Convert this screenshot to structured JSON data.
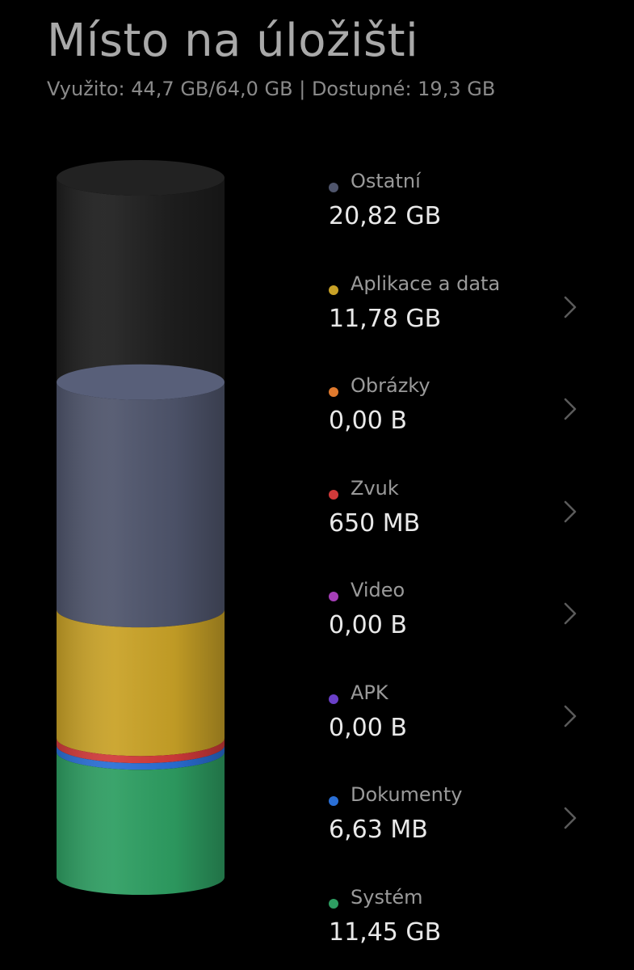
{
  "header": {
    "title": "Místo na úložišti",
    "summary": "Využito: 44,7 GB/64,0 GB | Dostupné: 19,3 GB"
  },
  "categories": [
    {
      "name": "Ostatní",
      "size": "20,82 GB",
      "color": "#4f556c",
      "has_chevron": false
    },
    {
      "name": "Aplikace a data",
      "size": "11,78 GB",
      "color": "#c9a227",
      "has_chevron": true
    },
    {
      "name": "Obrázky",
      "size": "0,00 B",
      "color": "#e07a2e",
      "has_chevron": true
    },
    {
      "name": "Zvuk",
      "size": "650 MB",
      "color": "#d23a3a",
      "has_chevron": true
    },
    {
      "name": "Video",
      "size": "0,00 B",
      "color": "#a63fb8",
      "has_chevron": true
    },
    {
      "name": "APK",
      "size": "0,00 B",
      "color": "#6a3fc8",
      "has_chevron": true
    },
    {
      "name": "Dokumenty",
      "size": "6,63 MB",
      "color": "#2a6fd6",
      "has_chevron": true
    },
    {
      "name": "Systém",
      "size": "11,45 GB",
      "color": "#2e9e62",
      "has_chevron": false
    }
  ],
  "storage_bar": {
    "total_gb": 64.0,
    "segments_bottom_to_top": [
      {
        "name": "Systém",
        "gb": 11.45,
        "color": "#2e9e62"
      },
      {
        "name": "Dokumenty",
        "gb": 0.6,
        "color": "#2a6fd6"
      },
      {
        "name": "Zvuk",
        "gb": 0.65,
        "color": "#d23a3a"
      },
      {
        "name": "Aplikace a data",
        "gb": 11.78,
        "color": "#c9a227"
      },
      {
        "name": "Ostatní",
        "gb": 20.82,
        "color": "#4f556c"
      }
    ],
    "free_color": "#1e1e1e"
  }
}
